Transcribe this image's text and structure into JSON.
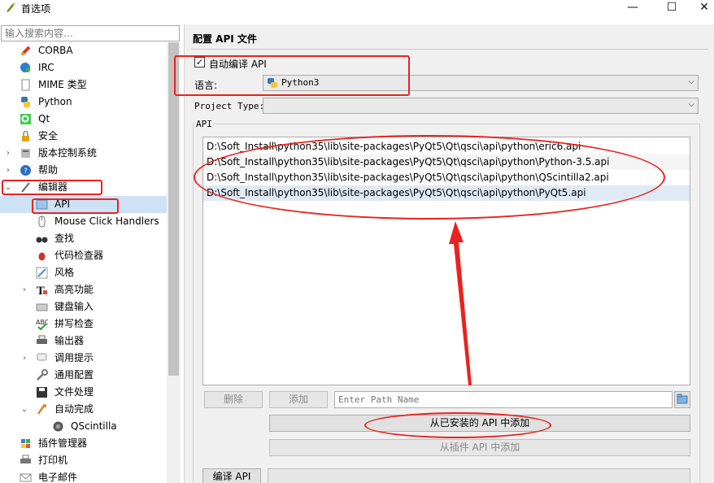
{
  "window": {
    "title": "首选项",
    "minimize": "—",
    "maximize": "☐",
    "close": "✕"
  },
  "sidebar": {
    "search_placeholder": "输入搜索内容…",
    "items": [
      {
        "label": "CORBA",
        "icon": "corba-icon"
      },
      {
        "label": "IRC",
        "icon": "irc-icon"
      },
      {
        "label": "MIME 类型",
        "icon": "mime-icon"
      },
      {
        "label": "Python",
        "icon": "python-icon"
      },
      {
        "label": "Qt",
        "icon": "qt-icon"
      },
      {
        "label": "安全",
        "icon": "lock-icon"
      },
      {
        "label": "版本控制系统",
        "icon": "vcs-icon"
      },
      {
        "label": "帮助",
        "icon": "help-icon"
      },
      {
        "label": "编辑器",
        "icon": "editor-icon"
      },
      {
        "label": "API",
        "icon": "api-icon"
      },
      {
        "label": "Mouse Click Handlers",
        "icon": "mouse-icon"
      },
      {
        "label": "查找",
        "icon": "binoculars-icon"
      },
      {
        "label": "代码检查器",
        "icon": "bug-icon"
      },
      {
        "label": "风格",
        "icon": "style-icon"
      },
      {
        "label": "高亮功能",
        "icon": "highlight-icon"
      },
      {
        "label": "键盘输入",
        "icon": "keyboard-icon"
      },
      {
        "label": "拼写检查",
        "icon": "spellcheck-icon"
      },
      {
        "label": "输出器",
        "icon": "printer-icon"
      },
      {
        "label": "调用提示",
        "icon": "calltip-icon"
      },
      {
        "label": "通用配置",
        "icon": "wrench-icon"
      },
      {
        "label": "文件处理",
        "icon": "save-icon"
      },
      {
        "label": "自动完成",
        "icon": "autocomplete-icon"
      },
      {
        "label": "QScintilla",
        "icon": "qscintilla-icon"
      },
      {
        "label": "插件管理器",
        "icon": "plugin-icon"
      },
      {
        "label": "打印机",
        "icon": "printer-icon"
      },
      {
        "label": "电子邮件",
        "icon": "email-icon"
      }
    ]
  },
  "main": {
    "title": "配置 API 文件",
    "auto_compile_label": "自动编译 API",
    "auto_compile_checked": true,
    "language_label": "语言:",
    "language_value": "Python3",
    "project_type_label": "Project Type:",
    "project_type_value": "",
    "group_label": "API",
    "api_files": [
      "D:\\Soft_Install\\python35\\lib\\site-packages\\PyQt5\\Qt\\qsci\\api\\python\\eric6.api",
      "D:\\Soft_Install\\python35\\lib\\site-packages\\PyQt5\\Qt\\qsci\\api\\python\\Python-3.5.api",
      "D:\\Soft_Install\\python35\\lib\\site-packages\\PyQt5\\Qt\\qsci\\api\\python\\QScintilla2.api",
      "D:\\Soft_Install\\python35\\lib\\site-packages\\PyQt5\\Qt\\qsci\\api\\python\\PyQt5.api"
    ],
    "delete_button": "删除",
    "add_button": "添加",
    "path_placeholder": "Enter Path Name",
    "add_installed_button": "从已安装的 API 中添加",
    "add_plugin_button": "从插件 API 中添加",
    "compile_button": "编译 API"
  },
  "colors": {
    "annotation": "#e8231f",
    "selection": "#cde3f5"
  }
}
